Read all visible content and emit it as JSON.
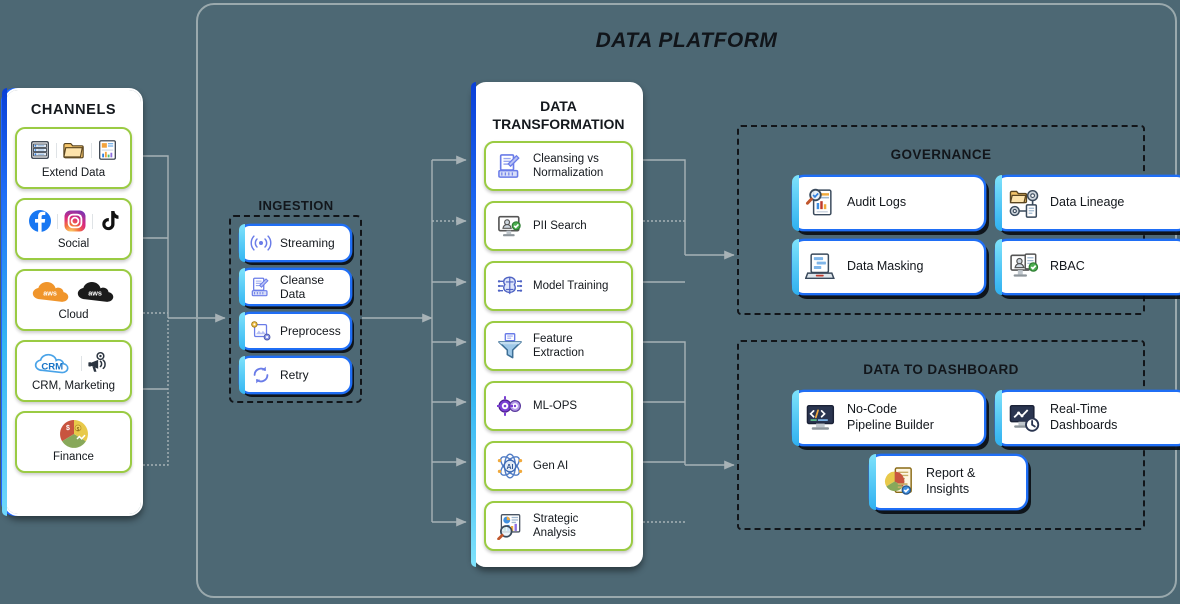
{
  "platform": {
    "title": "DATA PLATFORM"
  },
  "channels": {
    "title": "CHANNELS",
    "items": [
      {
        "label": "Extend Data",
        "icons": [
          "server-icon",
          "folder-icon",
          "report-icon"
        ]
      },
      {
        "label": "Social",
        "icons": [
          "facebook-icon",
          "instagram-icon",
          "tiktok-icon"
        ]
      },
      {
        "label": "Cloud",
        "icons": [
          "aws-cloud-orange-icon",
          "aws-cloud-dark-icon"
        ]
      },
      {
        "label": "CRM, Marketing",
        "icons": [
          "crm-cloud-icon",
          "megaphone-gear-icon"
        ]
      },
      {
        "label": "Finance",
        "icons": [
          "pie-chart-finance-icon"
        ]
      }
    ]
  },
  "ingestion": {
    "title": "INGESTION",
    "items": [
      {
        "label": "Streaming",
        "icon": "broadcast-signal-icon"
      },
      {
        "label": "Cleanse Data",
        "icon": "document-broom-icon"
      },
      {
        "label": "Preprocess",
        "icon": "image-gear-icon"
      },
      {
        "label": "Retry",
        "icon": "refresh-cycle-icon"
      }
    ]
  },
  "transformation": {
    "title": "DATA\nTRANSFORMATION",
    "title_line1": "DATA",
    "title_line2": "TRANSFORMATION",
    "items": [
      {
        "label": "Cleansing vs Normalization",
        "line1": "Cleansing vs",
        "line2": "Normalization",
        "icon": "document-broom-icon"
      },
      {
        "label": "PII Search",
        "line1": "PII Search",
        "line2": "",
        "icon": "monitor-user-search-icon"
      },
      {
        "label": "Model Training",
        "line1": "Model Training",
        "line2": "",
        "icon": "ai-brain-chip-icon"
      },
      {
        "label": "Feature Extraction",
        "line1": "Feature",
        "line2": "Extraction",
        "icon": "funnel-document-icon"
      },
      {
        "label": "ML-OPS",
        "line1": "ML-OPS",
        "line2": "",
        "icon": "gears-mlops-icon"
      },
      {
        "label": "Gen AI",
        "line1": "Gen AI",
        "line2": "",
        "icon": "atom-ai-icon"
      },
      {
        "label": "Strategic Analysis",
        "line1": "Strategic",
        "line2": "Analysis",
        "icon": "chart-magnifier-icon"
      }
    ]
  },
  "governance": {
    "title": "GOVERNANCE",
    "items": [
      {
        "label": "Audit Logs",
        "icon": "magnifier-report-icon"
      },
      {
        "label": "Data Lineage",
        "icon": "folder-gear-nodes-icon"
      },
      {
        "label": "Data Masking",
        "icon": "laptop-mask-icon"
      },
      {
        "label": "RBAC",
        "icon": "monitor-user-badge-icon"
      }
    ]
  },
  "dashboard": {
    "title": "DATA TO DASHBOARD",
    "items": [
      {
        "label": "No-Code Pipeline Builder",
        "line1": "No-Code",
        "line2": "Pipeline Builder",
        "icon": "code-monitor-icon"
      },
      {
        "label": "Real-Time Dashboards",
        "line1": "Real-Time",
        "line2": "Dashboards",
        "icon": "monitor-chart-clock-icon"
      },
      {
        "label": "Report & Insights",
        "line1": "Report &",
        "line2": "Insights",
        "icon": "pie-report-icon"
      }
    ]
  },
  "colors": {
    "background": "#4d6874",
    "accent_blue": "#1f6ef5",
    "accent_cyan": "#35b6f2",
    "accent_green": "#9acb43",
    "wire": "#a7b2b6",
    "frame": "#9aa9ad"
  }
}
